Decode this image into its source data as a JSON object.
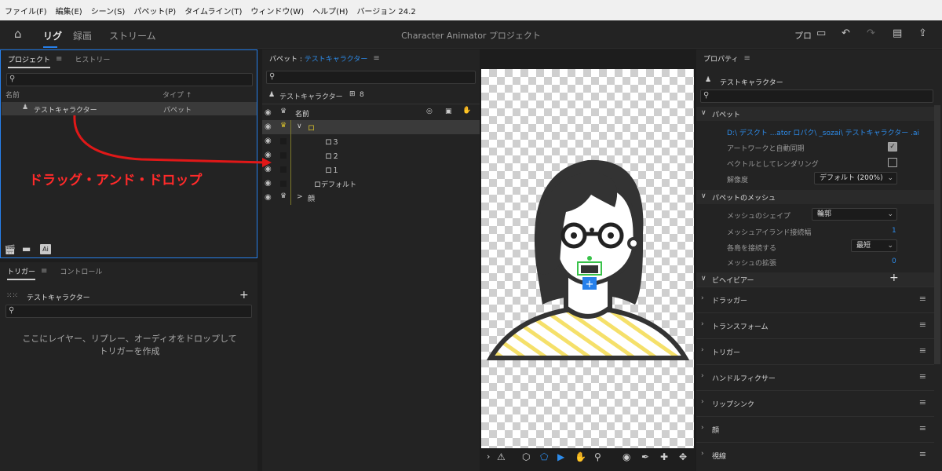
{
  "menu": [
    "ファイル(F)",
    "編集(E)",
    "シーン(S)",
    "パペット(P)",
    "タイムライン(T)",
    "ウィンドウ(W)",
    "ヘルプ(H)",
    "バージョン 24.2"
  ],
  "workspaces": {
    "rig": "リグ",
    "record": "録画",
    "stream": "ストリーム"
  },
  "app_title": "Character Animator プロジェクト",
  "topright": {
    "pro": "プロ"
  },
  "project_panel": {
    "tab_project": "プロジェクト",
    "tab_history": "ヒストリー",
    "col_name": "名前",
    "col_type": "タイプ ↑",
    "item_name": "テストキャラクター",
    "item_type": "パペット",
    "overlay": "ドラッグ・アンド・ドロップ",
    "ai_badge": "Ai"
  },
  "trigger_panel": {
    "tab_trigger": "トリガー",
    "tab_control": "コントロール",
    "puppet": "テストキャラクター",
    "empty": "ここにレイヤー、リプレー、オーディオをドロップしてトリガーを作成"
  },
  "puppet_panel": {
    "title_prefix": "パペット : ",
    "title_name": "テストキャラクター",
    "puppet_name": "テストキャラクター",
    "count": "8",
    "col_name": "名前",
    "layers": [
      {
        "label": "ロ",
        "indent": 0,
        "chev": "∨",
        "crown": true
      },
      {
        "label": "ロ３",
        "indent": 2
      },
      {
        "label": "ロ２",
        "indent": 2
      },
      {
        "label": "ロ１",
        "indent": 2
      },
      {
        "label": "ロデフォルト",
        "indent": 1
      },
      {
        "label": "顔",
        "indent": 0,
        "chev": ">",
        "crown": true
      }
    ]
  },
  "properties": {
    "header": "プロパティ",
    "puppet": "テストキャラクター",
    "sec_puppet": "パペット",
    "path": "D:\\ デスクト ...ator ロパク\\ _sozai\\ テストキャラクター .ai",
    "artwork_sync": "アートワークと自動同期",
    "vector_render": "ベクトルとしてレンダリング",
    "resolution_label": "解像度",
    "resolution_value": "デフォルト (200%)",
    "sec_mesh": "パペットのメッシュ",
    "mesh_shape_label": "メッシュのシェイプ",
    "mesh_shape_value": "輪郭",
    "island_label": "メッシュアイランド接続幅",
    "island_value": "1",
    "connect_label": "各島を接続する",
    "connect_value": "最短",
    "expand_label": "メッシュの拡張",
    "expand_value": "0",
    "sec_behavior": "ビヘイビアー",
    "behaviors": [
      "ドラッガー",
      "トランスフォーム",
      "トリガー",
      "ハンドルフィクサー",
      "リップシンク",
      "顔",
      "視線"
    ]
  },
  "colors": {
    "accent": "#2680eb",
    "arrow": "#e01818",
    "overlay_text": "#ff2a2a",
    "stripe": "#f5e06a"
  }
}
